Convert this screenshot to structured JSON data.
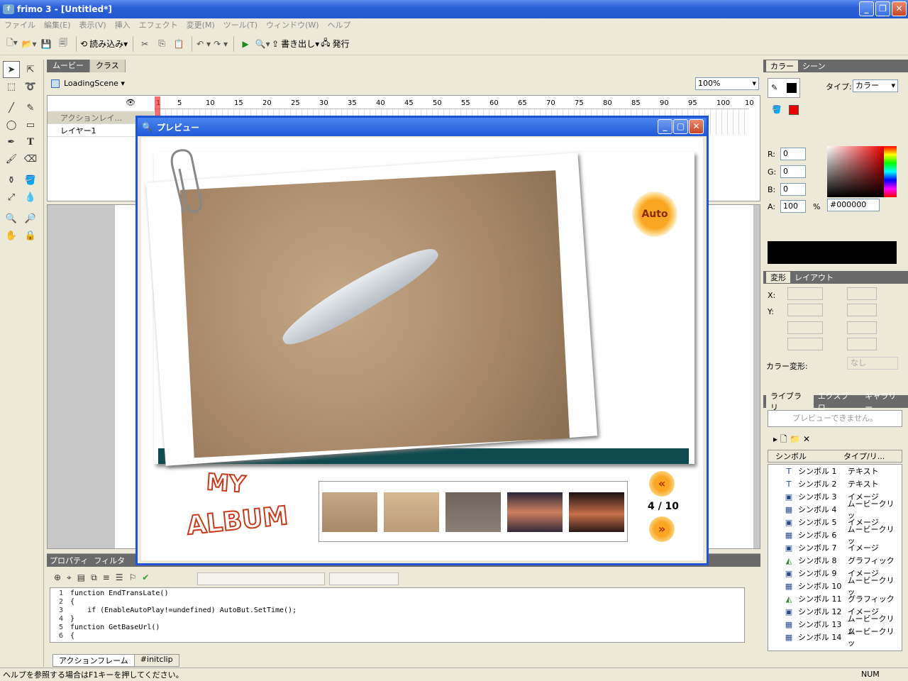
{
  "app": {
    "title": "frimo 3 - [Untitled*]"
  },
  "menu": [
    "ファイル",
    "編集(E)",
    "表示(V)",
    "挿入",
    "エフェクト",
    "変更(M)",
    "ツール(T)",
    "ウィンドウ(W)",
    "ヘルプ"
  ],
  "toolbar": {
    "import_label": "読み込み",
    "export_label": "書き出し",
    "publish_label": "発行"
  },
  "timeline": {
    "tabs": [
      "ムービー",
      "クラス"
    ],
    "scene": "LoadingScene",
    "zoom": "100%",
    "ruler_ticks": [
      "1",
      "5",
      "10",
      "15",
      "20",
      "25",
      "30",
      "35",
      "40",
      "45",
      "50",
      "55",
      "60",
      "65",
      "70",
      "75",
      "80",
      "85",
      "90",
      "95",
      "100",
      "10"
    ],
    "layers": [
      "アクションレイ...",
      "レイヤー1"
    ]
  },
  "props_tabs": [
    "プロパティ",
    "フィルタ"
  ],
  "code": {
    "lines": [
      {
        "n": "1",
        "t": "function EndTransLate()"
      },
      {
        "n": "2",
        "t": "{"
      },
      {
        "n": "3",
        "t": "    if (EnableAutoPlay!=undefined) AutoBut.SetTime();"
      },
      {
        "n": "4",
        "t": "}"
      },
      {
        "n": "5",
        "t": "function GetBaseUrl()"
      },
      {
        "n": "6",
        "t": "{"
      }
    ],
    "tabs": [
      "アクションフレーム",
      "#initclip"
    ]
  },
  "status": {
    "help": "ヘルプを参照する場合はF1キーを押してください。",
    "num": "NUM"
  },
  "color_panel": {
    "tabs": [
      "カラー",
      "シーン"
    ],
    "type_label": "タイプ:",
    "type_value": "カラー",
    "r_label": "R:",
    "r": "0",
    "g_label": "G:",
    "g": "0",
    "b_label": "B:",
    "b": "0",
    "a_label": "A:",
    "a": "100",
    "pct": "%",
    "hex": "#000000"
  },
  "transform_panel": {
    "tabs": [
      "変形",
      "レイアウト"
    ],
    "x_label": "X:",
    "y_label": "Y:",
    "color_transform_label": "カラー変形:",
    "color_transform_value": "なし"
  },
  "library": {
    "tabs": [
      "ライブラリ",
      "エクスプロ",
      "ギャラリー"
    ],
    "preview_text": "プレビューできません。",
    "col_symbol": "シンボル",
    "col_type": "タイプ/リ...",
    "items": [
      {
        "name": "シンボル 1",
        "type": "テキスト",
        "icon": "text-icon"
      },
      {
        "name": "シンボル 2",
        "type": "テキスト",
        "icon": "text-icon"
      },
      {
        "name": "シンボル 3",
        "type": "イメージ",
        "icon": "image-icon"
      },
      {
        "name": "シンボル 4",
        "type": "ムービークリッ",
        "icon": "movieclip-icon"
      },
      {
        "name": "シンボル 5",
        "type": "イメージ",
        "icon": "image-icon"
      },
      {
        "name": "シンボル 6",
        "type": "ムービークリッ",
        "icon": "movieclip-icon"
      },
      {
        "name": "シンボル 7",
        "type": "イメージ",
        "icon": "image-icon"
      },
      {
        "name": "シンボル 8",
        "type": "グラフィック",
        "icon": "graphic-icon"
      },
      {
        "name": "シンボル 9",
        "type": "イメージ",
        "icon": "image-icon"
      },
      {
        "name": "シンボル 10",
        "type": "ムービークリッ",
        "icon": "movieclip-icon"
      },
      {
        "name": "シンボル 11",
        "type": "グラフィック",
        "icon": "graphic-icon"
      },
      {
        "name": "シンボル 12",
        "type": "イメージ",
        "icon": "image-icon"
      },
      {
        "name": "シンボル 13",
        "type": "ムービークリッ",
        "icon": "movieclip-icon"
      },
      {
        "name": "シンボル 14",
        "type": "ムービークリッ",
        "icon": "movieclip-icon"
      }
    ]
  },
  "preview": {
    "title": "プレビュー",
    "auto_label": "Auto",
    "album_line1": "MY",
    "album_line2": "ALBUM",
    "page_counter": "4 / 10"
  },
  "colors": {
    "accent": "#1e55d6",
    "teal_bar": "#0e4a4e",
    "auto_orange": "#f7a21b",
    "album_red": "#c83a1a"
  }
}
